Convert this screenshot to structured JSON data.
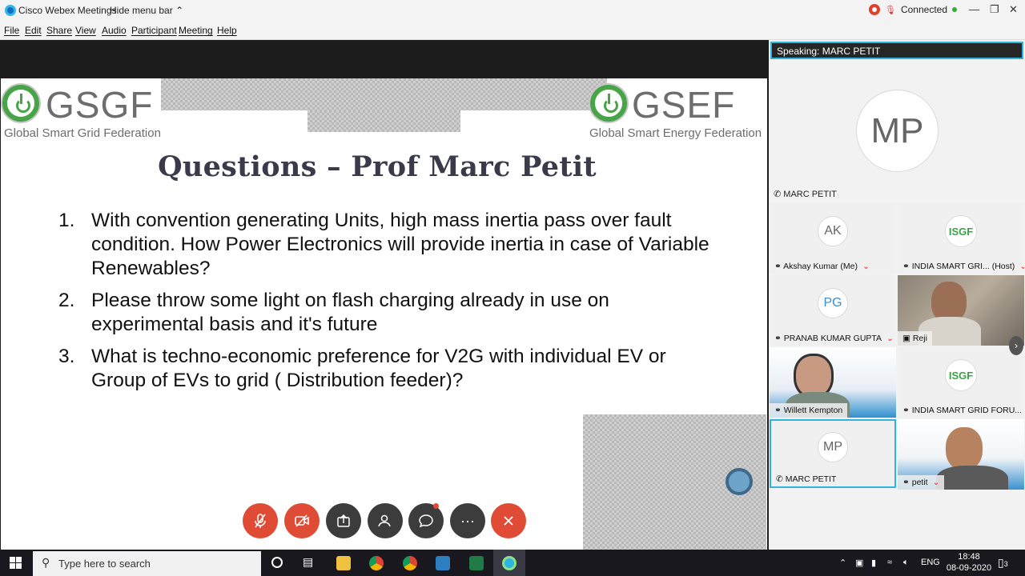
{
  "titlebar": {
    "app_name": "Cisco Webex Meetings",
    "hide_menu": "Hide menu bar",
    "status": "Connected"
  },
  "menu": [
    "File",
    "Edit",
    "Share",
    "View",
    "Audio",
    "Participant",
    "Meeting",
    "Help"
  ],
  "slide": {
    "logo_left_text": "GSGF",
    "logo_left_sub": "Global Smart Grid Federation",
    "logo_right_text": "GSEF",
    "logo_right_sub": "Global Smart Energy Federation",
    "title": "Questions – Prof Marc Petit",
    "questions": [
      {
        "num": "1.",
        "text": "With convention generating Units, high mass inertia pass over fault condition. How Power Electronics will provide inertia in case of Variable Renewables?"
      },
      {
        "num": "2.",
        "text": "Please throw some light on flash charging already in use on experimental basis and it's future"
      },
      {
        "num": "3.",
        "text": "What is techno-economic preference for V2G with individual EV or Group of EVs to grid ( Distribution feeder)?"
      }
    ]
  },
  "controls": {
    "mute_icon": "mic-muted-icon",
    "video_icon": "video-off-icon",
    "share_icon": "share-icon",
    "participants_icon": "participants-icon",
    "chat_icon": "chat-icon",
    "more_label": "···",
    "end_icon": "close-icon"
  },
  "panel": {
    "speaking_label": "Speaking:",
    "speaking_name": "MARC PETIT",
    "active_initials": "MP",
    "active_name": "MARC PETIT",
    "tiles": [
      {
        "initials": "AK",
        "name": "Akshay Kumar",
        "suffix": "(Me)"
      },
      {
        "logo": "ISGF",
        "name": "INDIA SMART GRI...",
        "suffix": "(Host)"
      },
      {
        "initials": "PG",
        "name": "PRANAB KUMAR GUPTA",
        "suffix": ""
      },
      {
        "video": true,
        "name": "Reji",
        "suffix": ""
      },
      {
        "video": true,
        "name": "Willett Kempton",
        "suffix": ""
      },
      {
        "logo": "ISGF",
        "name": "INDIA SMART GRID FORU...",
        "suffix": ""
      },
      {
        "initials": "MP",
        "name": "MARC PETIT",
        "suffix": ""
      },
      {
        "video": true,
        "name": "petit",
        "suffix": ""
      }
    ]
  },
  "taskbar": {
    "search_placeholder": "Type here to search",
    "lang": "ENG",
    "time": "18:48",
    "date": "08-09-2020",
    "notification_count": "3"
  }
}
